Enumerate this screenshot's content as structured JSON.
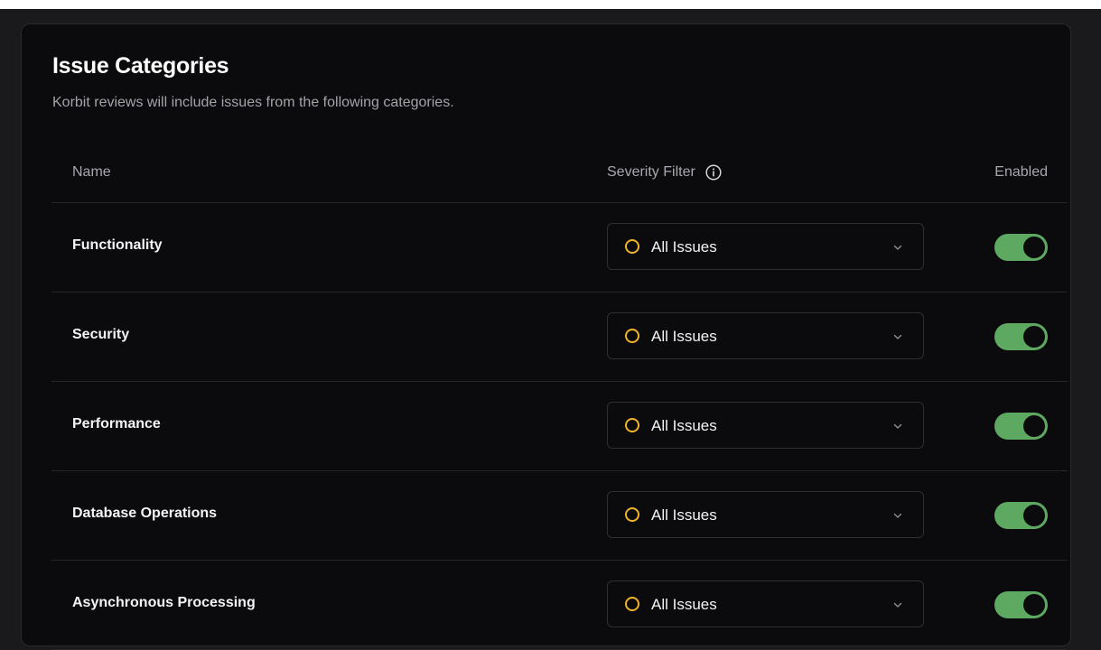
{
  "header": {
    "title": "Issue Categories",
    "subtitle": "Korbit reviews will include issues from the following categories."
  },
  "table": {
    "columns": {
      "name": "Name",
      "severity": "Severity Filter",
      "enabled": "Enabled"
    },
    "rows": [
      {
        "name": "Functionality",
        "severity": "All Issues",
        "enabled": true
      },
      {
        "name": "Security",
        "severity": "All Issues",
        "enabled": true
      },
      {
        "name": "Performance",
        "severity": "All Issues",
        "enabled": true
      },
      {
        "name": "Database Operations",
        "severity": "All Issues",
        "enabled": true
      },
      {
        "name": "Asynchronous Processing",
        "severity": "All Issues",
        "enabled": true
      }
    ]
  },
  "colors": {
    "toggle_on": "#5ea961",
    "severity_icon": "#f0b429",
    "card_bg": "#0b0b0d"
  },
  "icons": {
    "info": "info-circle-icon",
    "severity": "circle-outline-icon",
    "dropdown": "chevron-down-icon"
  }
}
